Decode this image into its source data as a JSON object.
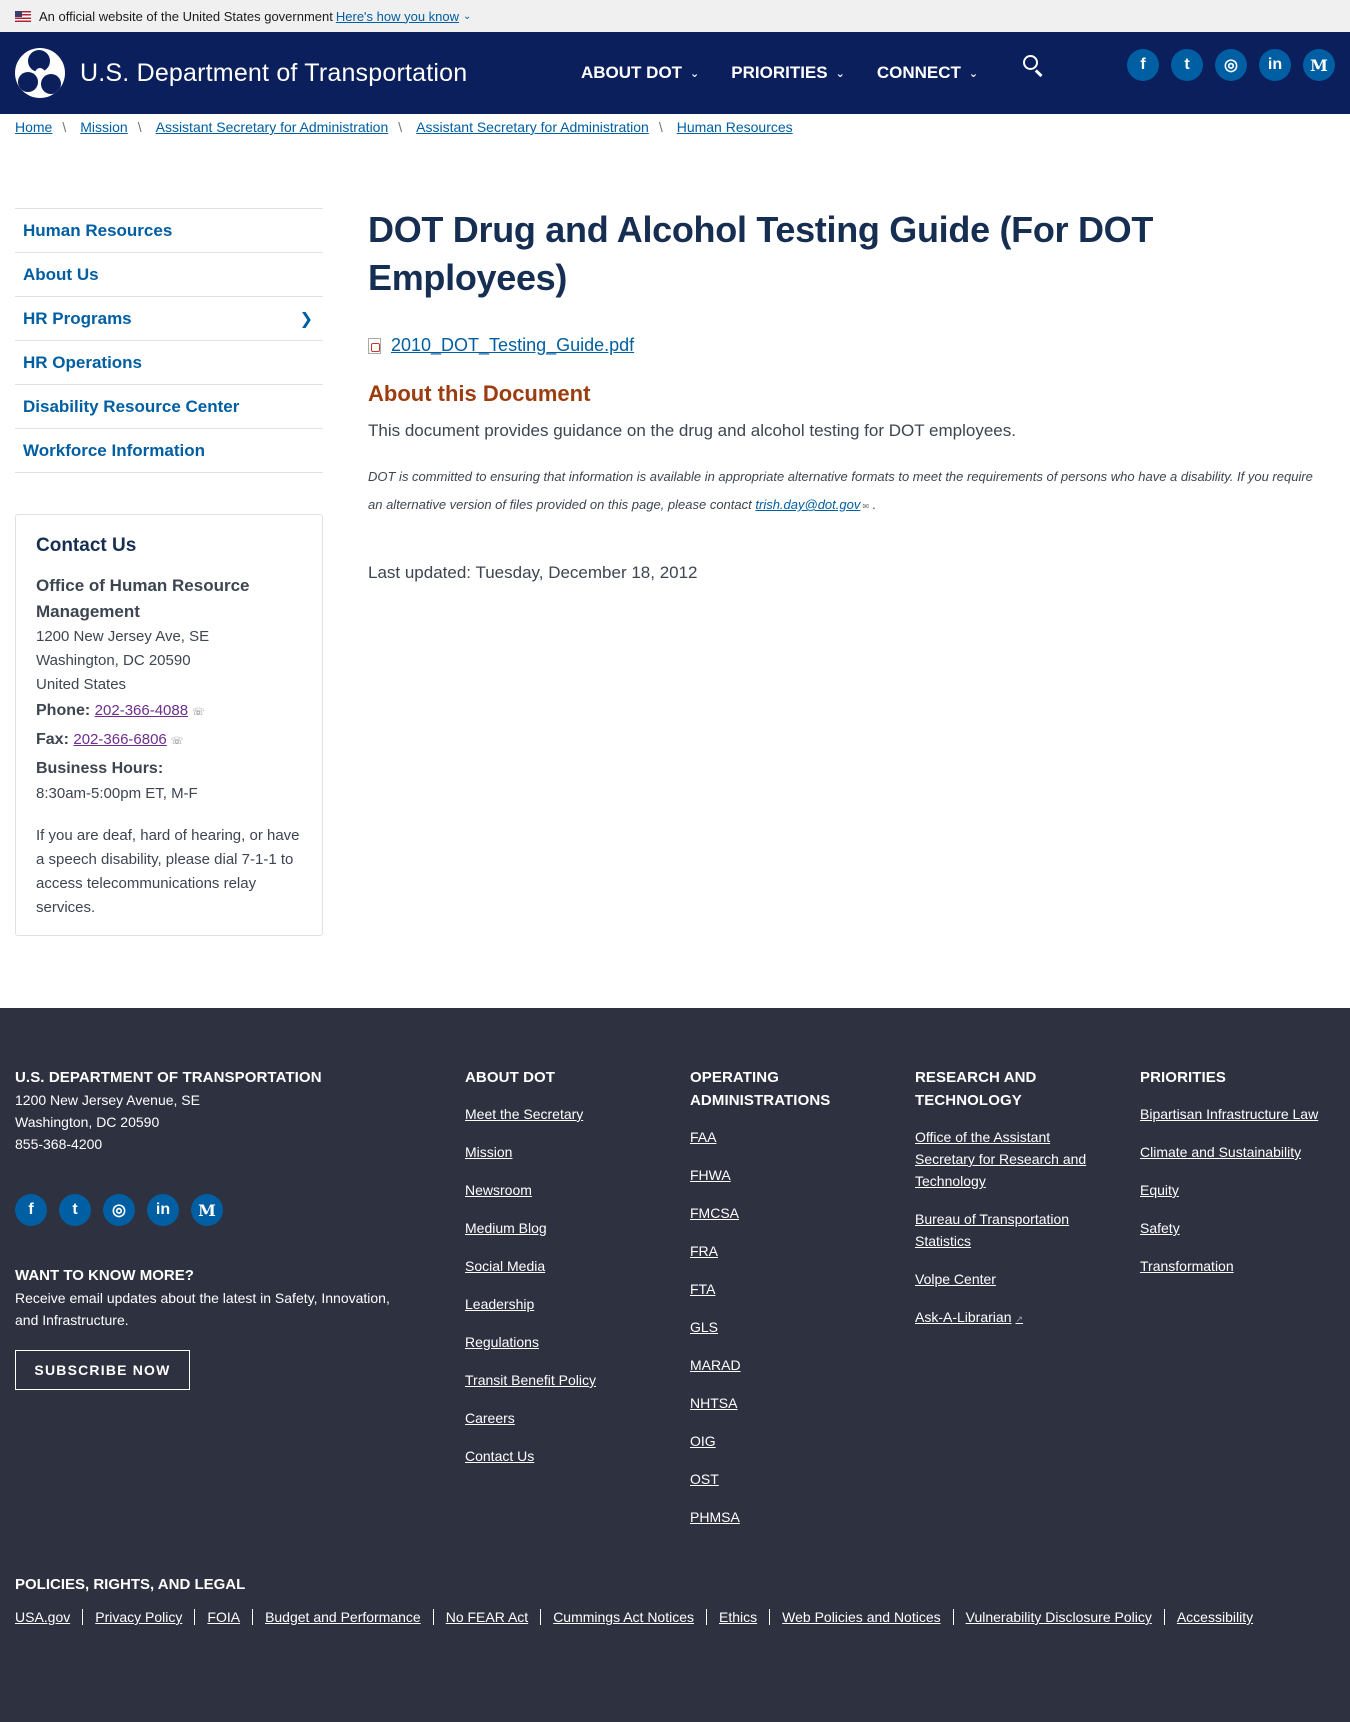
{
  "banner": {
    "text": "An official website of the United States government",
    "link": "Here's how you know"
  },
  "header": {
    "site_name": "U.S. Department of Transportation",
    "nav": [
      "ABOUT DOT",
      "PRIORITIES",
      "CONNECT"
    ],
    "social": [
      "f",
      "t",
      "ig",
      "in",
      "M"
    ]
  },
  "breadcrumb": [
    "Home",
    "Mission",
    "Assistant Secretary for Administration",
    "Assistant Secretary for Administration",
    "Human Resources"
  ],
  "sidebar": {
    "items": [
      {
        "label": "Human Resources",
        "has_children": false
      },
      {
        "label": "About Us",
        "has_children": false
      },
      {
        "label": "HR Programs",
        "has_children": true
      },
      {
        "label": "HR Operations",
        "has_children": false
      },
      {
        "label": "Disability Resource Center",
        "has_children": false
      },
      {
        "label": "Workforce Information",
        "has_children": false
      }
    ]
  },
  "contact": {
    "title": "Contact Us",
    "office": "Office of Human Resource Management",
    "address": [
      "1200 New Jersey Ave, SE",
      "Washington, DC 20590",
      "United States"
    ],
    "phone_label": "Phone:",
    "phone": "202-366-4088",
    "fax_label": "Fax:",
    "fax": "202-366-6806",
    "hours_label": "Business Hours:",
    "hours": "8:30am-5:00pm ET, M-F",
    "note": "If you are deaf, hard of hearing, or have a speech disability, please dial 7-1-1 to access telecommunications relay services."
  },
  "main": {
    "title": "DOT Drug and Alcohol Testing Guide (For DOT Employees)",
    "file": "2010_DOT_Testing_Guide.pdf",
    "about_heading": "About this Document",
    "description": "This document provides guidance on the drug and alcohol testing for DOT employees.",
    "accessibility_note": "DOT is committed to ensuring that information is available in appropriate alternative formats to meet the requirements of persons who have a disability. If you require an alternative version of files provided on this page, please contact",
    "contact_email": "trish.day@dot.gov",
    "updated": "Last updated: Tuesday, December 18, 2012"
  },
  "footer": {
    "org": "U.S. DEPARTMENT OF TRANSPORTATION",
    "address": [
      "1200 New Jersey Avenue, SE",
      "Washington, DC 20590",
      "855-368-4200"
    ],
    "want_heading": "WANT TO KNOW MORE?",
    "want_text": "Receive email updates about the latest in Safety, Innovation, and Infrastructure.",
    "subscribe": "SUBSCRIBE NOW",
    "about_heading": "ABOUT DOT",
    "about_links": [
      "Meet the Secretary",
      "Mission",
      "Newsroom",
      "Medium Blog",
      "Social Media",
      "Leadership",
      "Regulations",
      "Transit Benefit Policy",
      "Careers",
      "Contact Us"
    ],
    "oa_heading": "OPERATING ADMINISTRATIONS",
    "oa_links": [
      "FAA",
      "FHWA",
      "FMCSA",
      "FRA",
      "FTA",
      "GLS",
      "MARAD",
      "NHTSA",
      "OIG",
      "OST",
      "PHMSA"
    ],
    "rt_heading": "RESEARCH AND TECHNOLOGY",
    "rt_links": [
      "Office of the Assistant Secretary for Research and Technology",
      "Bureau of Transportation Statistics",
      "Volpe Center",
      "Ask-A-Librarian"
    ],
    "pr_heading": "PRIORITIES",
    "pr_links": [
      "Bipartisan Infrastructure Law",
      "Climate and Sustainability",
      "Equity",
      "Safety",
      "Transformation"
    ],
    "policies_heading": "POLICIES, RIGHTS, AND LEGAL",
    "policies": [
      "USA.gov",
      "Privacy Policy",
      "FOIA",
      "Budget and Performance",
      "No FEAR Act",
      "Cummings Act Notices",
      "Ethics",
      "Web Policies and Notices",
      "Vulnerability Disclosure Policy",
      "Accessibility"
    ]
  },
  "colors": {
    "header_bg": "#0b1f5c",
    "link": "#005ea2",
    "heading": "#162e51",
    "about_heading": "#9c3d10",
    "footer_bg": "#2d3140"
  }
}
